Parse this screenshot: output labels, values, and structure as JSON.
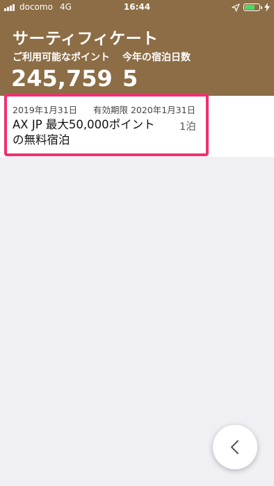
{
  "status_bar": {
    "carrier": "docomo",
    "network": "4G",
    "time": "16:44",
    "battery_level": 0.6
  },
  "header": {
    "title": "サーティフィケート",
    "points_label": "ご利用可能なポイント",
    "nights_label": "今年の宿泊日数",
    "points_value": "245,759",
    "nights_value": "5"
  },
  "certificates": [
    {
      "date": "2019年1月31日",
      "expiry": "有効期限 2020年1月31日",
      "name": "AX JP 最大50,000ポイントの無料宿泊",
      "count": "1泊"
    }
  ],
  "colors": {
    "header_bg": "#8c6d45",
    "highlight": "#f0306e",
    "battery": "#4cd964"
  },
  "icons": {
    "back": "chevron-left-icon",
    "location": "location-arrow-icon",
    "charge": "bolt-icon"
  }
}
